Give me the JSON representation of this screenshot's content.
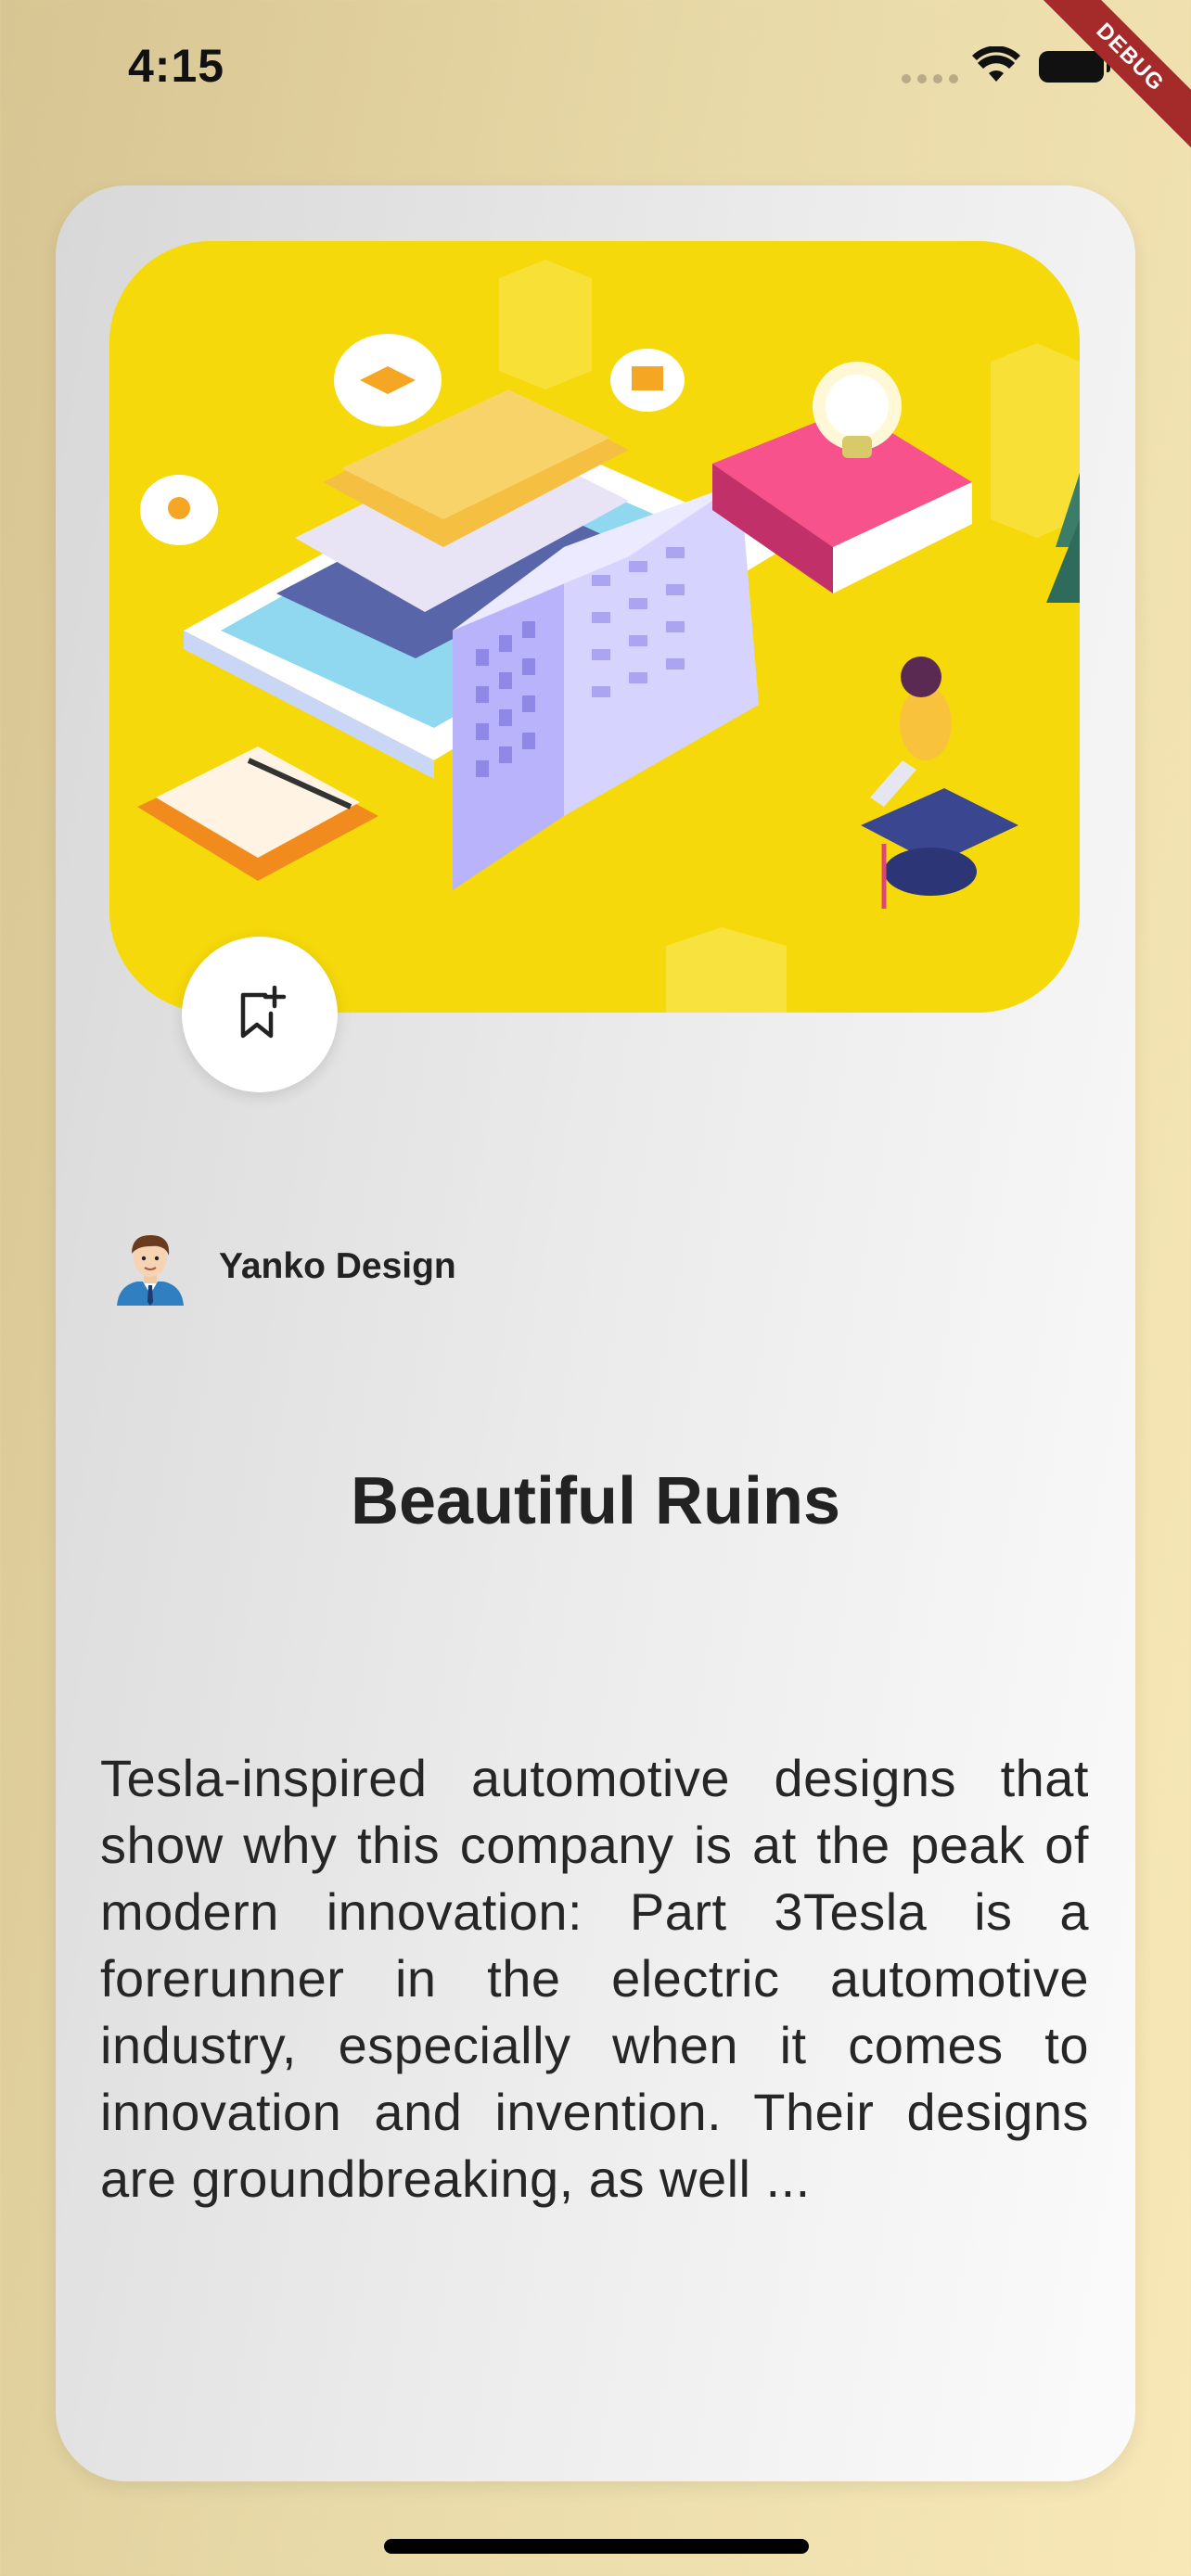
{
  "status_bar": {
    "time": "4:15",
    "debug_label": "DEBUG"
  },
  "card": {
    "hero_image": "isometric-education-illustration",
    "author": {
      "avatar": "man-avatar-icon",
      "name": "Yanko Design"
    },
    "title": "Beautiful Ruins",
    "description": "Tesla-inspired automotive designs that show why this company is at the peak of modern innovation: Part 3Tesla is a forerunner in the electric automotive industry, especially when it comes to innovation and invention. Their designs are groundbreaking, as well ..."
  },
  "colors": {
    "hero_background": "#f6d90a",
    "debug_ribbon": "#a52a2a"
  }
}
